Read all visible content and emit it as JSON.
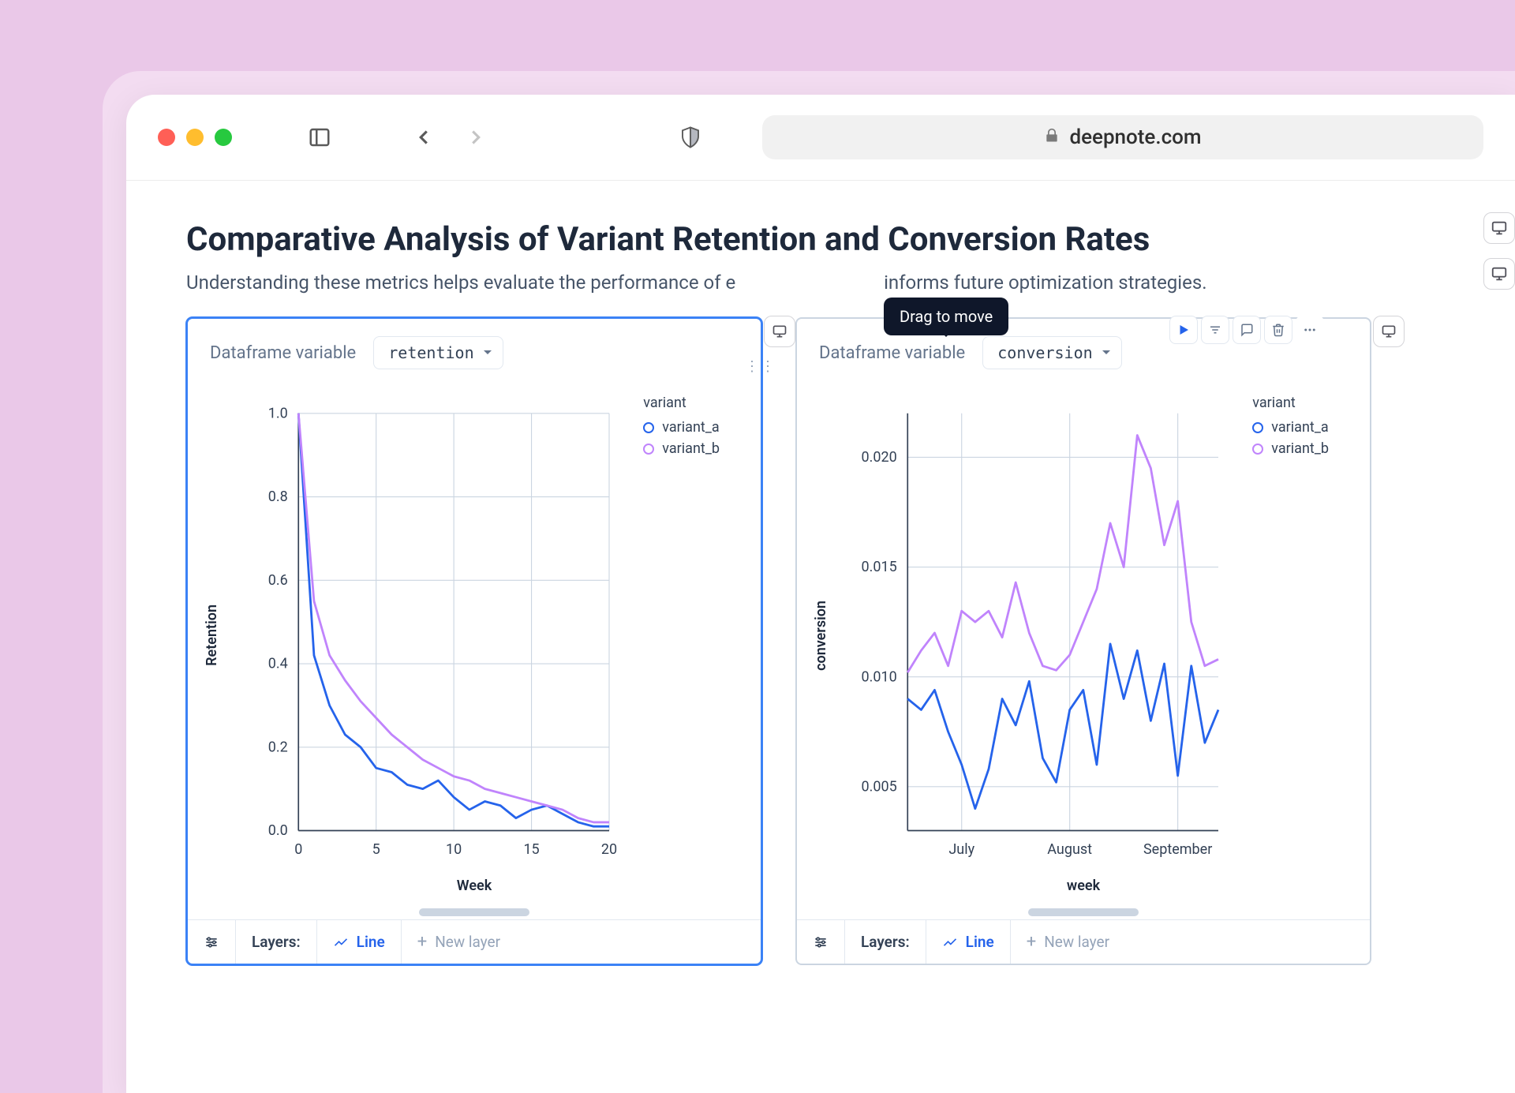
{
  "browser": {
    "url": "deepnote.com"
  },
  "page": {
    "title": "Comparative Analysis of Variant Retention and Conversion Rates",
    "subtitle_pre": "Understanding these metrics helps evaluate the performance of e",
    "subtitle_post": " informs future optimization strategies.",
    "tooltip": "Drag to move"
  },
  "card_common": {
    "df_label": "Dataframe variable",
    "layers_label": "Layers:",
    "line_btn": "Line",
    "new_layer": "New layer",
    "legend_title": "variant",
    "series_a": "variant_a",
    "series_b": "variant_b"
  },
  "card_left": {
    "df_value": "retention",
    "ylabel": "Retention",
    "xlabel": "Week"
  },
  "card_right": {
    "df_value": "conversion",
    "ylabel": "conversion",
    "xlabel": "week"
  },
  "colors": {
    "series_a": "#2563eb",
    "series_b": "#c084fc",
    "grid": "#cbd5e1",
    "axis": "#334155"
  },
  "chart_data": [
    {
      "type": "line",
      "title": "Retention",
      "xlabel": "Week",
      "ylabel": "Retention",
      "x": [
        0,
        1,
        2,
        3,
        4,
        5,
        6,
        7,
        8,
        9,
        10,
        11,
        12,
        13,
        14,
        15,
        16,
        17,
        18,
        19,
        20
      ],
      "xlim": [
        0,
        20
      ],
      "ylim": [
        0,
        1
      ],
      "y_ticks": [
        0.0,
        0.2,
        0.4,
        0.6,
        0.8,
        1.0
      ],
      "x_ticks": [
        0,
        5,
        10,
        15,
        20
      ],
      "series": [
        {
          "name": "variant_a",
          "color": "#2563eb",
          "values": [
            1.0,
            0.42,
            0.3,
            0.23,
            0.2,
            0.15,
            0.14,
            0.11,
            0.1,
            0.12,
            0.08,
            0.05,
            0.07,
            0.06,
            0.03,
            0.05,
            0.06,
            0.04,
            0.02,
            0.01,
            0.01
          ]
        },
        {
          "name": "variant_b",
          "color": "#c084fc",
          "values": [
            1.0,
            0.55,
            0.42,
            0.36,
            0.31,
            0.27,
            0.23,
            0.2,
            0.17,
            0.15,
            0.13,
            0.12,
            0.1,
            0.09,
            0.08,
            0.07,
            0.06,
            0.05,
            0.03,
            0.02,
            0.02
          ]
        }
      ]
    },
    {
      "type": "line",
      "title": "conversion",
      "xlabel": "week",
      "ylabel": "conversion",
      "x_categories": [
        "July",
        "August",
        "September"
      ],
      "ylim": [
        0.003,
        0.022
      ],
      "y_ticks": [
        0.005,
        0.01,
        0.015,
        0.02
      ],
      "x_idx": [
        0,
        1,
        2,
        3,
        4,
        5,
        6,
        7,
        8,
        9,
        10,
        11,
        12,
        13,
        14,
        15,
        16,
        17,
        18,
        19,
        20,
        21,
        22,
        23
      ],
      "series": [
        {
          "name": "variant_a",
          "color": "#2563eb",
          "values": [
            0.009,
            0.0085,
            0.0094,
            0.0075,
            0.006,
            0.004,
            0.0058,
            0.009,
            0.0078,
            0.0098,
            0.0063,
            0.0052,
            0.0085,
            0.0094,
            0.006,
            0.0115,
            0.009,
            0.0112,
            0.008,
            0.0106,
            0.0055,
            0.0105,
            0.007,
            0.0085
          ]
        },
        {
          "name": "variant_b",
          "color": "#c084fc",
          "values": [
            0.0102,
            0.0112,
            0.012,
            0.0105,
            0.013,
            0.0125,
            0.013,
            0.0118,
            0.0143,
            0.012,
            0.0105,
            0.0103,
            0.011,
            0.0125,
            0.014,
            0.017,
            0.015,
            0.021,
            0.0195,
            0.016,
            0.018,
            0.0125,
            0.0105,
            0.0108
          ]
        }
      ]
    }
  ]
}
